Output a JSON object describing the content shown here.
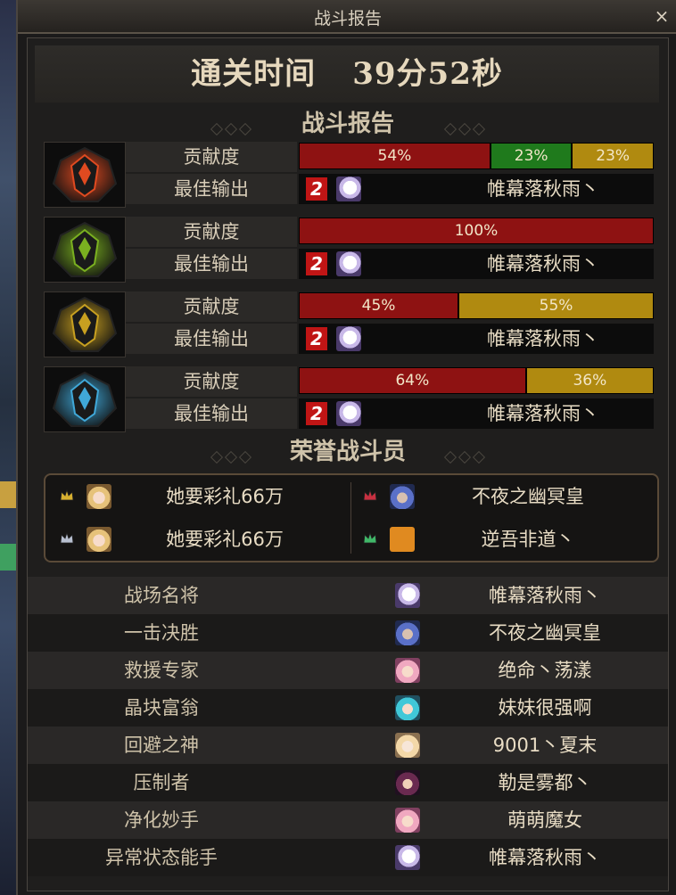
{
  "window": {
    "title": "战斗报告",
    "close": "×"
  },
  "time": {
    "label": "通关时间",
    "value": "39分52秒"
  },
  "report_heading": "战斗报告",
  "bosses": [
    {
      "row1_label": "贡献度",
      "row2_label": "最佳输出",
      "segments": [
        {
          "pct": 54,
          "text": "54%",
          "color": "red"
        },
        {
          "pct": 23,
          "text": "23%",
          "color": "green"
        },
        {
          "pct": 23,
          "text": "23%",
          "color": "gold"
        }
      ],
      "rank_badge": "2",
      "best_player": "帷幕落秋雨丶",
      "accent": "#e04a20"
    },
    {
      "row1_label": "贡献度",
      "row2_label": "最佳输出",
      "segments": [
        {
          "pct": 100,
          "text": "100%",
          "color": "red"
        }
      ],
      "rank_badge": "2",
      "best_player": "帷幕落秋雨丶",
      "accent": "#7ab020"
    },
    {
      "row1_label": "贡献度",
      "row2_label": "最佳输出",
      "segments": [
        {
          "pct": 45,
          "text": "45%",
          "color": "red"
        },
        {
          "pct": 55,
          "text": "55%",
          "color": "gold"
        }
      ],
      "rank_badge": "2",
      "best_player": "帷幕落秋雨丶",
      "accent": "#c8a020"
    },
    {
      "row1_label": "贡献度",
      "row2_label": "最佳输出",
      "segments": [
        {
          "pct": 64,
          "text": "64%",
          "color": "red"
        },
        {
          "pct": 36,
          "text": "36%",
          "color": "gold"
        }
      ],
      "rank_badge": "2",
      "best_player": "帷幕落秋雨丶",
      "accent": "#40a8d8"
    }
  ],
  "honor_heading": "荣誉战斗员",
  "honor": [
    {
      "name": "她要彩礼66万",
      "crown": "gold",
      "avatar": "blond"
    },
    {
      "name": "不夜之幽冥皇",
      "crown": "red",
      "avatar": "blue"
    },
    {
      "name": "她要彩礼66万",
      "crown": "silver",
      "avatar": "blond"
    },
    {
      "name": "逆吾非道丶",
      "crown": "green",
      "avatar": "orange"
    }
  ],
  "awards": [
    {
      "title": "战场名将",
      "player": "帷幕落秋雨丶",
      "avatar": "ghost"
    },
    {
      "title": "一击决胜",
      "player": "不夜之幽冥皇",
      "avatar": "blue"
    },
    {
      "title": "救援专家",
      "player": "绝命丶荡漾",
      "avatar": "pink"
    },
    {
      "title": "晶块富翁",
      "player": "妹妹很强啊",
      "avatar": "cyan"
    },
    {
      "title": "回避之神",
      "player": "9001丶夏末",
      "avatar": "cream"
    },
    {
      "title": "压制者",
      "player": "勒是雾都丶",
      "avatar": "dark"
    },
    {
      "title": "净化妙手",
      "player": "萌萌魔女",
      "avatar": "pink"
    },
    {
      "title": "异常状态能手",
      "player": "帷幕落秋雨丶",
      "avatar": "ghost"
    }
  ]
}
